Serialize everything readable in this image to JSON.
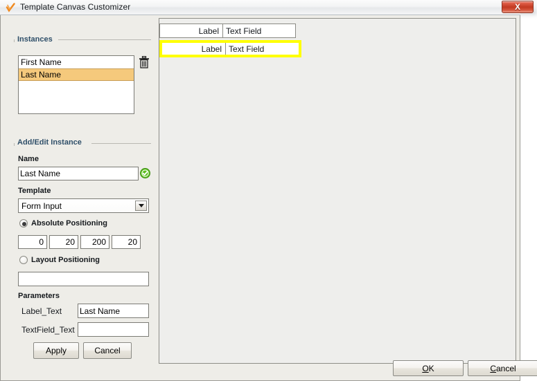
{
  "window": {
    "title": "Template Canvas Customizer",
    "icon": "checkmark-icon",
    "close_label": "X"
  },
  "background_window": {
    "visible": true
  },
  "instances_group": {
    "title": "Instances",
    "items": [
      {
        "label": "First Name",
        "selected": false
      },
      {
        "label": "Last Name",
        "selected": true
      }
    ],
    "delete_icon": "trash-icon"
  },
  "add_edit_group": {
    "title": "Add/Edit Instance",
    "name_label": "Name",
    "name_value": "Last Name",
    "name_valid_icon": "green-check-icon",
    "template_label": "Template",
    "template_value": "Form Input",
    "template_options": [
      "Form Input"
    ],
    "absolute_positioning": {
      "label": "Absolute Positioning",
      "selected": true,
      "values": [
        "0",
        "20",
        "200",
        "20"
      ]
    },
    "layout_positioning": {
      "label": "Layout Positioning",
      "selected": false,
      "value": ""
    },
    "parameters_label": "Parameters",
    "parameters": [
      {
        "name": "Label_Text",
        "value": "Last Name"
      },
      {
        "name": "TextField_Text",
        "value": ""
      }
    ],
    "apply_label": "Apply",
    "cancel_label": "Cancel"
  },
  "canvas": {
    "rows": [
      {
        "label": "Label",
        "textfield": "Text Field",
        "selected": false
      },
      {
        "label": "Label",
        "textfield": "Text Field",
        "selected": true
      }
    ],
    "selection_color": "#ffff00"
  },
  "footer": {
    "ok_mnemonic": "O",
    "ok_rest": "K",
    "cancel_mnemonic": "C",
    "cancel_rest": "ancel"
  },
  "colors": {
    "selection_highlight": "#f5c97c",
    "canvas_selection": "#ffff00",
    "group_title": "#2f4f69",
    "close_button": "#c23a22"
  }
}
